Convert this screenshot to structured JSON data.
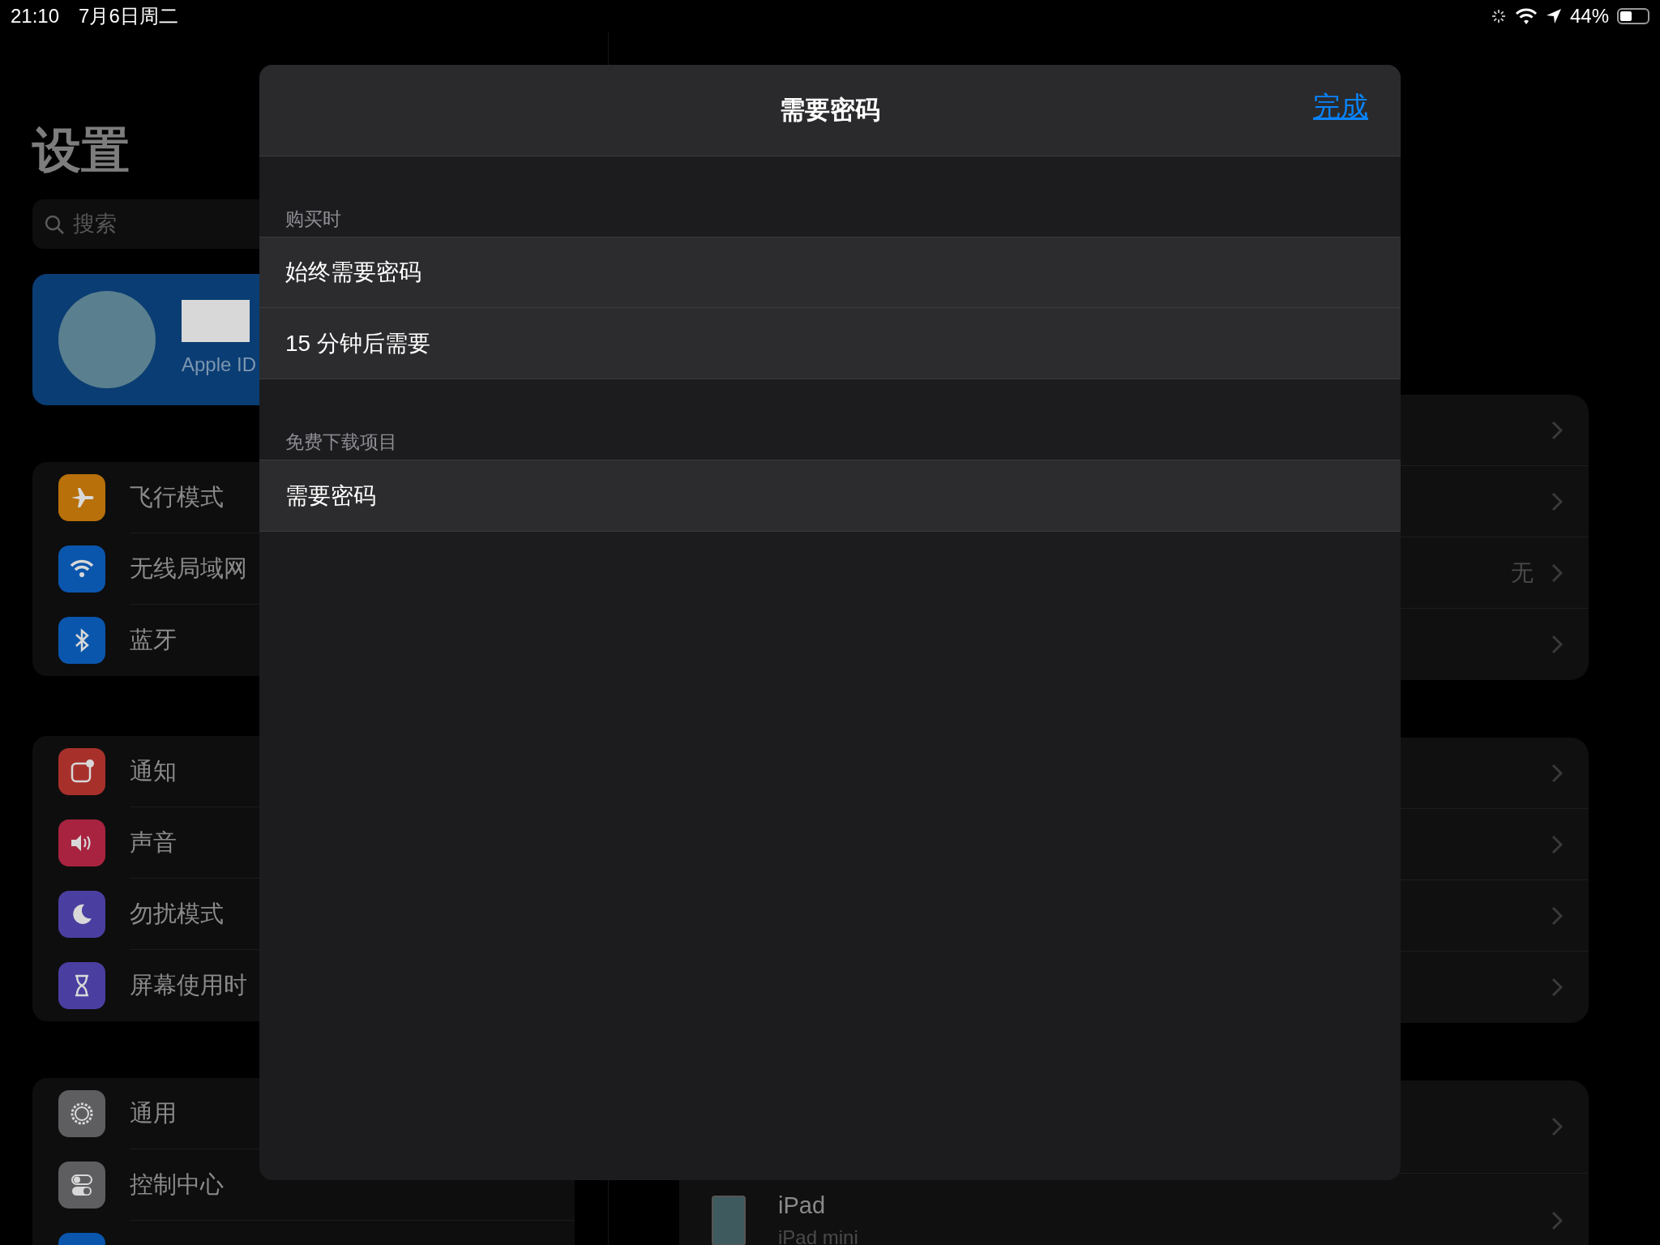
{
  "status_bar": {
    "time": "21:10",
    "date": "7月6日周二",
    "battery": {
      "label": "44%",
      "level": 0.44
    }
  },
  "sidebar": {
    "title": "设置",
    "search": {
      "placeholder": "搜索"
    },
    "profile": {
      "subtitle": "Apple ID"
    },
    "groups": [
      [
        {
          "label": "飞行模式",
          "color": "#b8700a"
        },
        {
          "label": "无线局域网",
          "color": "#0a56ad"
        },
        {
          "label": "蓝牙",
          "color": "#0a56ad"
        }
      ],
      [
        {
          "label": "通知",
          "color": "#a8302b"
        },
        {
          "label": "声音",
          "color": "#a8233f"
        },
        {
          "label": "勿扰模式",
          "color": "#4a3fa0"
        },
        {
          "label": "屏幕使用时",
          "color": "#4a3fa0"
        }
      ],
      [
        {
          "label": "通用",
          "color": "#5e5e60"
        },
        {
          "label": "控制中心",
          "color": "#5e5e60"
        },
        {
          "color": "#0a56ad"
        }
      ]
    ]
  },
  "detail": {
    "groups": [
      [
        {
          "kind": "link"
        },
        {
          "kind": "link"
        },
        {
          "kind": "value",
          "value": "无"
        },
        {
          "kind": "link"
        }
      ],
      [
        {
          "kind": "link"
        },
        {
          "kind": "link"
        },
        {
          "kind": "link"
        },
        {
          "kind": "link"
        }
      ],
      [
        {
          "kind": "link"
        },
        {
          "kind": "device",
          "device": "iPad",
          "model": "iPad mini"
        }
      ]
    ]
  },
  "modal": {
    "title": "需要密码",
    "done": "完成",
    "sections": [
      {
        "header": "购买时",
        "rows": [
          {
            "label": "始终需要密码"
          },
          {
            "label": "15 分钟后需要"
          }
        ]
      },
      {
        "header": "免费下载项目",
        "rows": [
          {
            "label": "需要密码"
          }
        ]
      }
    ]
  }
}
